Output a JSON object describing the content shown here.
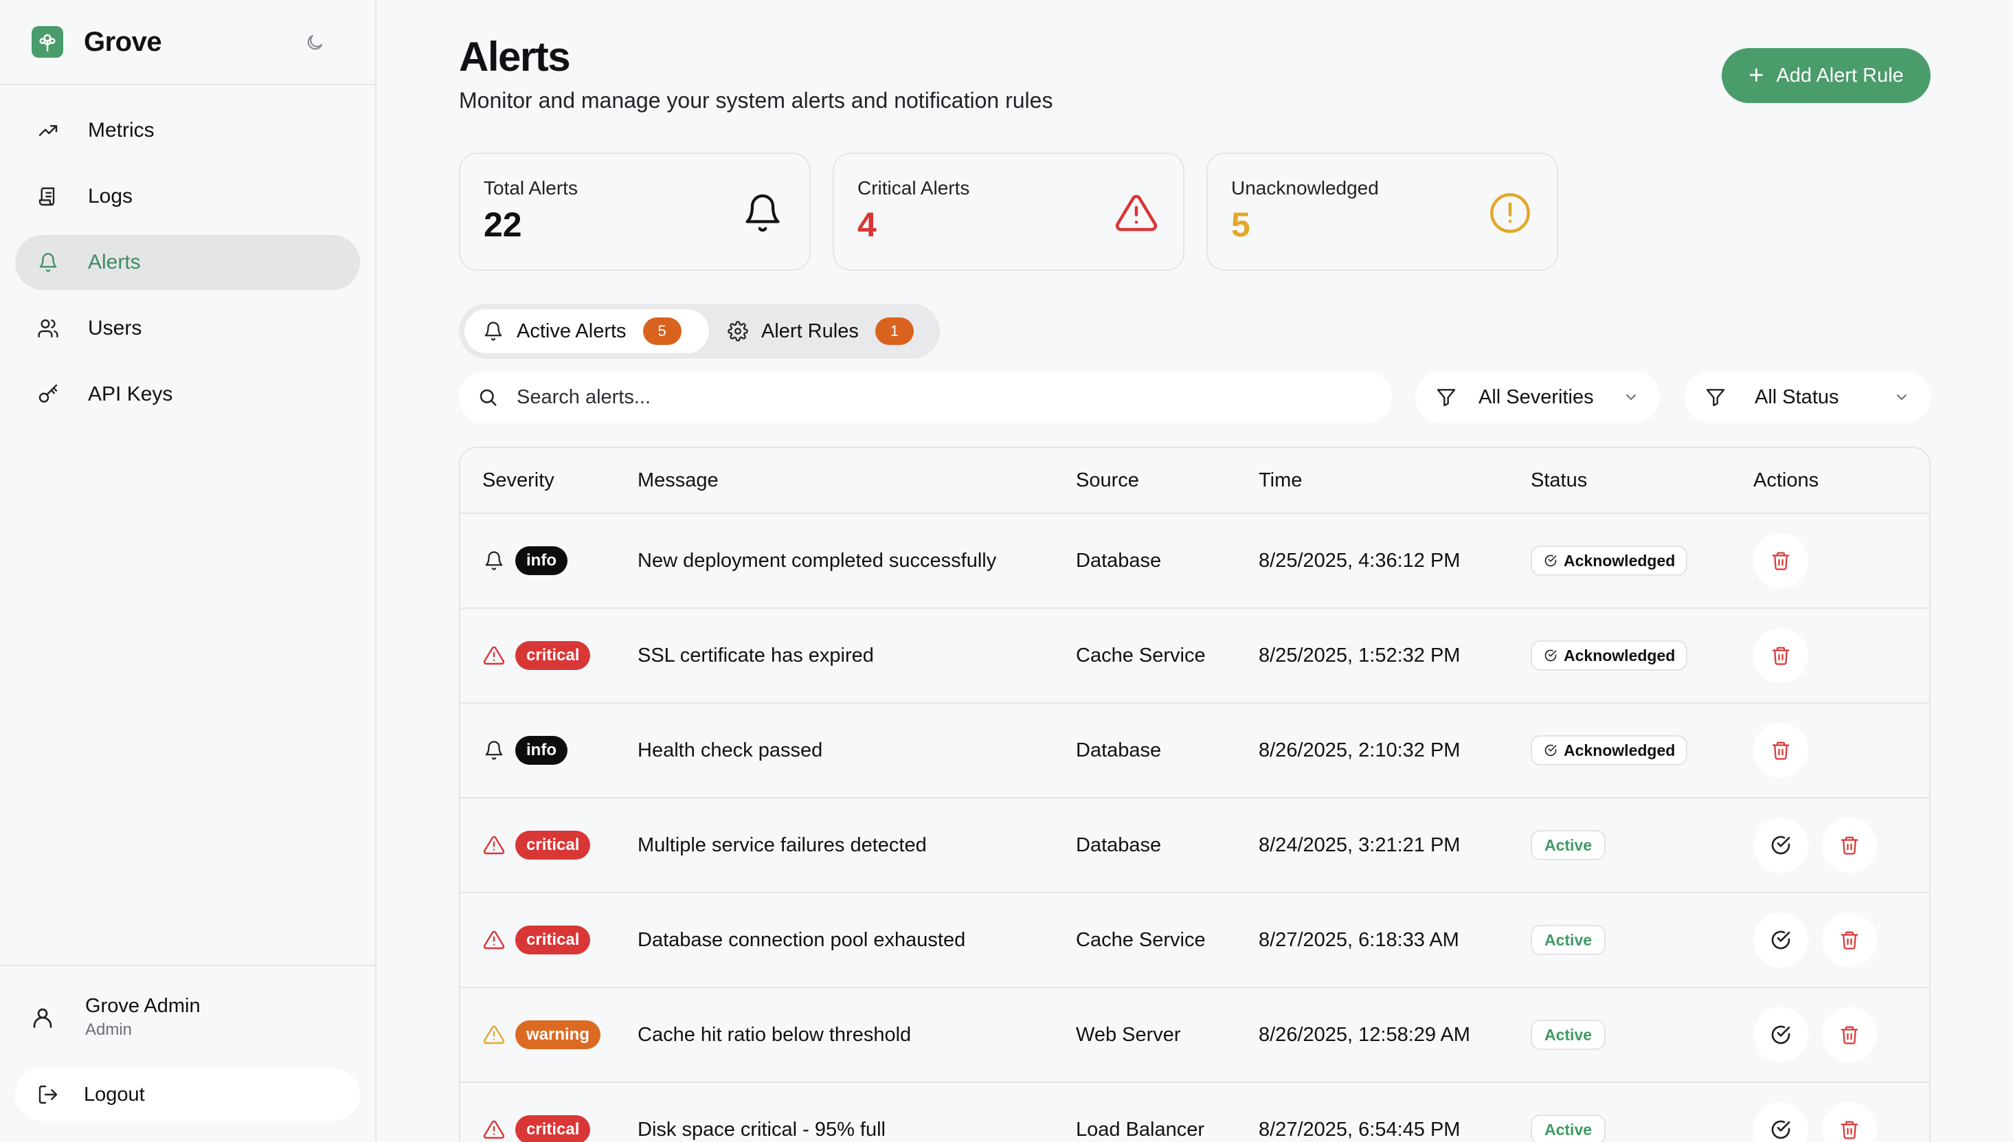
{
  "app": {
    "name": "Grove"
  },
  "nav": {
    "items": [
      {
        "label": "Metrics",
        "icon": "trending-up-icon"
      },
      {
        "label": "Logs",
        "icon": "logs-icon"
      },
      {
        "label": "Alerts",
        "icon": "bell-icon",
        "active": true
      },
      {
        "label": "Users",
        "icon": "users-icon"
      },
      {
        "label": "API Keys",
        "icon": "key-icon"
      }
    ]
  },
  "user": {
    "name": "Grove Admin",
    "role": "Admin",
    "logout_label": "Logout"
  },
  "page": {
    "title": "Alerts",
    "subtitle": "Monitor and manage your system alerts and notification rules",
    "add_button": "Add Alert Rule"
  },
  "stats": [
    {
      "label": "Total Alerts",
      "value": "22",
      "color": "#0f1115",
      "icon": "bell-icon"
    },
    {
      "label": "Critical Alerts",
      "value": "4",
      "color": "#d93636",
      "icon": "warning-triangle-icon"
    },
    {
      "label": "Unacknowledged",
      "value": "5",
      "color": "#e2a82a",
      "icon": "alert-circle-icon"
    }
  ],
  "tabs": [
    {
      "label": "Active Alerts",
      "count": "5",
      "icon": "bell-icon",
      "active": true
    },
    {
      "label": "Alert Rules",
      "count": "1",
      "icon": "gear-icon"
    }
  ],
  "search": {
    "placeholder": "Search alerts..."
  },
  "filters": {
    "severity": "All Severities",
    "status": "All Status"
  },
  "table": {
    "headers": {
      "severity": "Severity",
      "message": "Message",
      "source": "Source",
      "time": "Time",
      "status": "Status",
      "actions": "Actions"
    },
    "rows": [
      {
        "severity": "info",
        "message": "New deployment completed successfully",
        "source": "Database",
        "time": "8/25/2025, 4:36:12 PM",
        "status": "Acknowledged"
      },
      {
        "severity": "critical",
        "message": "SSL certificate has expired",
        "source": "Cache Service",
        "time": "8/25/2025, 1:52:32 PM",
        "status": "Acknowledged"
      },
      {
        "severity": "info",
        "message": "Health check passed",
        "source": "Database",
        "time": "8/26/2025, 2:10:32 PM",
        "status": "Acknowledged"
      },
      {
        "severity": "critical",
        "message": "Multiple service failures detected",
        "source": "Database",
        "time": "8/24/2025, 3:21:21 PM",
        "status": "Active"
      },
      {
        "severity": "critical",
        "message": "Database connection pool exhausted",
        "source": "Cache Service",
        "time": "8/27/2025, 6:18:33 AM",
        "status": "Active"
      },
      {
        "severity": "warning",
        "message": "Cache hit ratio below threshold",
        "source": "Web Server",
        "time": "8/26/2025, 12:58:29 AM",
        "status": "Active"
      },
      {
        "severity": "critical",
        "message": "Disk space critical - 95% full",
        "source": "Load Balancer",
        "time": "8/27/2025, 6:54:45 PM",
        "status": "Active"
      }
    ]
  },
  "colors": {
    "brand": "#4a9c6b",
    "critical": "#d93636",
    "warning": "#dc6a22",
    "info": "#0c0d0f",
    "active_status": "#3e9b63"
  }
}
